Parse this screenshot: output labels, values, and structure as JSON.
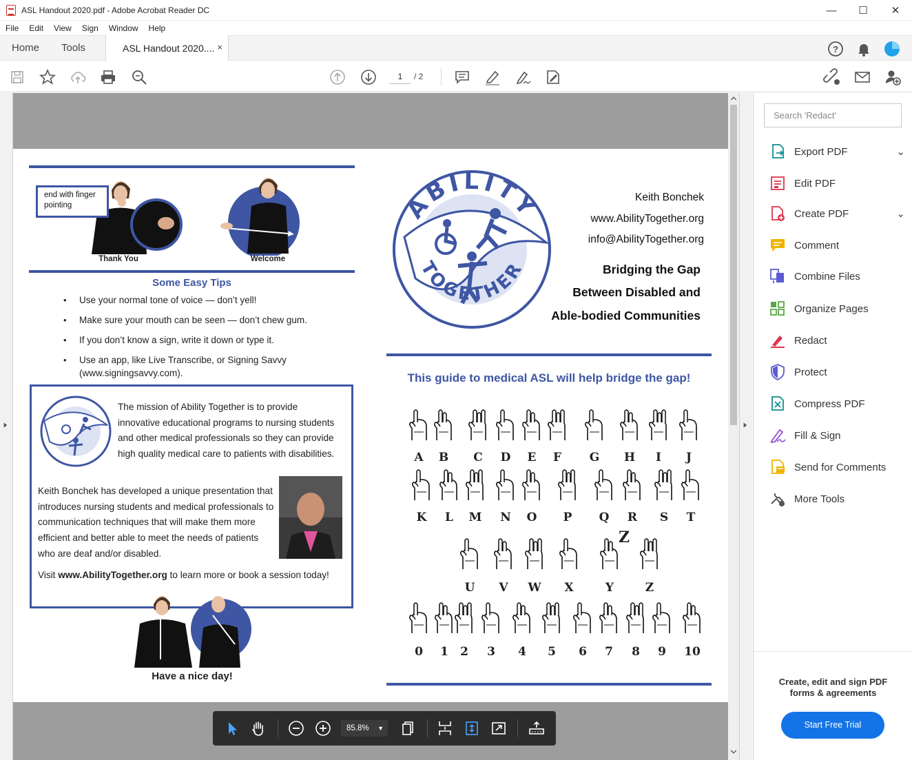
{
  "window": {
    "title": "ASL Handout 2020.pdf - Adobe Acrobat Reader DC",
    "controls": [
      "—",
      "☐",
      "✕"
    ]
  },
  "menu": [
    "File",
    "Edit",
    "View",
    "Sign",
    "Window",
    "Help"
  ],
  "tabs": {
    "home": "Home",
    "tools": "Tools",
    "document": "ASL Handout 2020....",
    "close": "×"
  },
  "toolbar": {
    "page_current": "1",
    "page_total": "/ 2"
  },
  "search": {
    "placeholder": "Search 'Redact'"
  },
  "tools_panel": [
    {
      "label": "Export PDF",
      "icon": "export-pdf-icon",
      "color": "#0e8f8f",
      "chevron": "⌄"
    },
    {
      "label": "Edit PDF",
      "icon": "edit-pdf-icon",
      "color": "#e0344d",
      "chevron": ""
    },
    {
      "label": "Create PDF",
      "icon": "create-pdf-icon",
      "color": "#e0344d",
      "chevron": "⌄"
    },
    {
      "label": "Comment",
      "icon": "comment-icon",
      "color": "#f0b400",
      "chevron": ""
    },
    {
      "label": "Combine Files",
      "icon": "combine-files-icon",
      "color": "#5b5bd6",
      "chevron": ""
    },
    {
      "label": "Organize Pages",
      "icon": "organize-pages-icon",
      "color": "#56a846",
      "chevron": ""
    },
    {
      "label": "Redact",
      "icon": "redact-icon",
      "color": "#e0344d",
      "chevron": ""
    },
    {
      "label": "Protect",
      "icon": "protect-icon",
      "color": "#5b5bd6",
      "chevron": ""
    },
    {
      "label": "Compress PDF",
      "icon": "compress-pdf-icon",
      "color": "#0e8f8f",
      "chevron": ""
    },
    {
      "label": "Fill & Sign",
      "icon": "fill-sign-icon",
      "color": "#8e4fd0",
      "chevron": ""
    },
    {
      "label": "Send for Comments",
      "icon": "send-comments-icon",
      "color": "#f0b400",
      "chevron": ""
    },
    {
      "label": "More Tools",
      "icon": "more-tools-icon",
      "color": "#555555",
      "chevron": ""
    }
  ],
  "promo": {
    "line1": "Create, edit and sign PDF",
    "line2": "forms & agreements",
    "button": "Start Free Trial"
  },
  "floating_toolbar": {
    "zoom": "85.8%"
  },
  "pdf": {
    "callout": "end with finger pointing",
    "sign_thank_you": "Thank You",
    "sign_welcome": "Welcome",
    "tips_heading": "Some Easy Tips",
    "tips": [
      "Use your normal tone of voice — don’t  yell!",
      "Make sure your mouth can be seen — don’t chew gum.",
      "If you don’t know a sign, write it down or type it.",
      "Use an app, like Live Transcribe, or Signing Savvy (www.signingsavvy.com)."
    ],
    "mission": "The mission of Ability Together is to provide innovative educational programs to nursing students and other medical professionals so they can provide high quality medical care to patients with disabilities.",
    "bio": "Keith Bonchek has developed a unique presentation that introduces nursing students and medical professionals to communication techniques that will make them more efficient and better able to meet the needs of patients who are deaf and/or disabled.",
    "visit_pre": "Visit ",
    "visit_link": "www.AbilityTogether.org",
    "visit_post": " to learn more or book a session today!",
    "nice_day": "Have a nice day!",
    "logo_top": "ABILITY",
    "logo_bottom": "TOGETHER",
    "contact_name": "Keith Bonchek",
    "contact_web": "www.AbilityTogether.org",
    "contact_email": "info@AbilityTogether.org",
    "tagline": [
      "Bridging the Gap",
      "Between Disabled and",
      "Able-bodied Communities"
    ],
    "guide_heading": "This guide to medical ASL will help bridge the gap!",
    "alphabet_rows": [
      [
        "A",
        "B",
        "C",
        "D",
        "E",
        "F",
        "G",
        "H",
        "I",
        "J"
      ],
      [
        "K",
        "L",
        "M",
        "N",
        "O",
        "P",
        "Q",
        "R",
        "S",
        "T"
      ],
      [
        "U",
        "V",
        "W",
        "X",
        "Y",
        "Z"
      ],
      [
        "0",
        "1",
        "2",
        "3",
        "4",
        "5",
        "6",
        "7",
        "8",
        "9",
        "10"
      ]
    ],
    "z_mark": "Z"
  }
}
